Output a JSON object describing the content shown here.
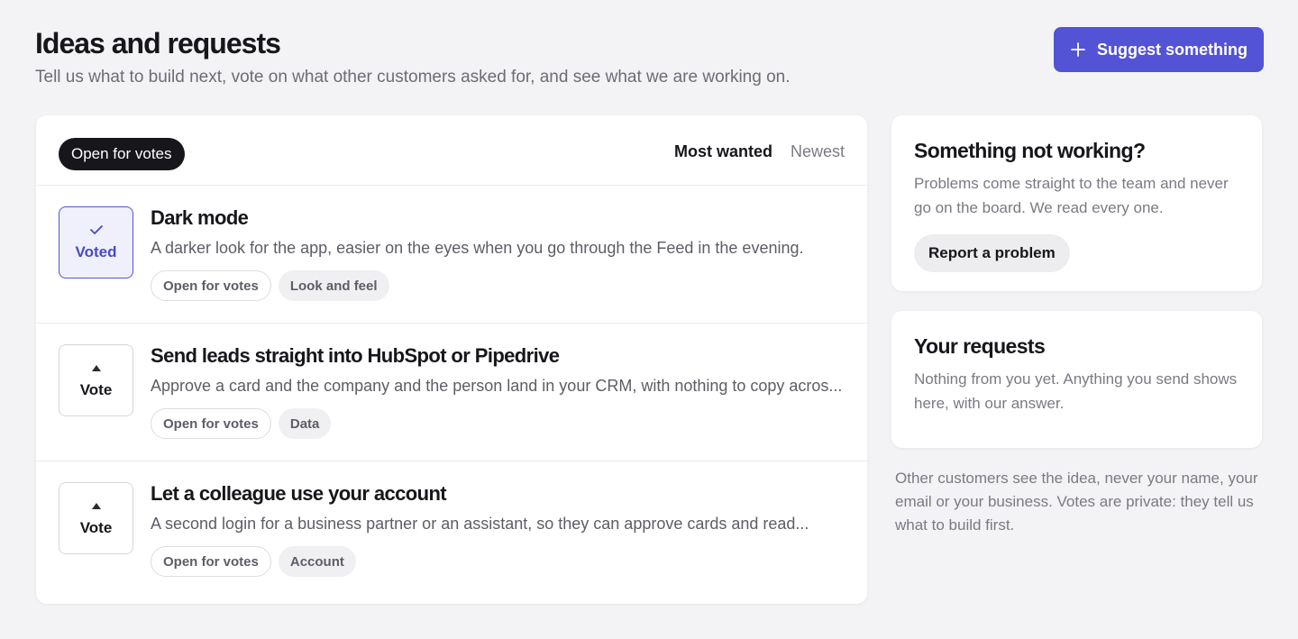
{
  "header": {
    "title": "Ideas and requests",
    "subtitle": "Tell us what to build next, vote on what other customers asked for, and see what we are working on.",
    "suggest_label": "Suggest something"
  },
  "board": {
    "filter_label": "Open for votes",
    "sort_tabs": [
      {
        "label": "Most wanted",
        "active": true
      },
      {
        "label": "Newest",
        "active": false
      }
    ],
    "ideas": [
      {
        "vote_label": "Voted",
        "voted": true,
        "title": "Dark mode",
        "description": "A darker look for the app, easier on the eyes when you go through the Feed in the evening.",
        "status": "Open for votes",
        "category": "Look and feel"
      },
      {
        "vote_label": "Vote",
        "voted": false,
        "title": "Send leads straight into HubSpot or Pipedrive",
        "description": "Approve a card and the company and the person land in your CRM, with nothing to copy acros...",
        "status": "Open for votes",
        "category": "Data"
      },
      {
        "vote_label": "Vote",
        "voted": false,
        "title": "Let a colleague use your account",
        "description": "A second login for a business partner or an assistant, so they can approve cards and read...",
        "status": "Open for votes",
        "category": "Account"
      }
    ]
  },
  "problem_card": {
    "title": "Something not working?",
    "text": "Problems come straight to the team and never go on the board. We read every one.",
    "button_label": "Report a problem"
  },
  "requests_card": {
    "title": "Your requests",
    "text": "Nothing from you yet. Anything you send shows here, with our answer."
  },
  "privacy_note": "Other customers see the idea, never your name, your email or your business. Votes are private: they tell us what to build first.",
  "colors": {
    "accent": "#5353d6",
    "background": "#f3f3f5",
    "dark": "#16161b"
  },
  "icons": {
    "suggest": "plus-icon",
    "voted": "check-icon",
    "vote": "triangle-up-icon"
  }
}
